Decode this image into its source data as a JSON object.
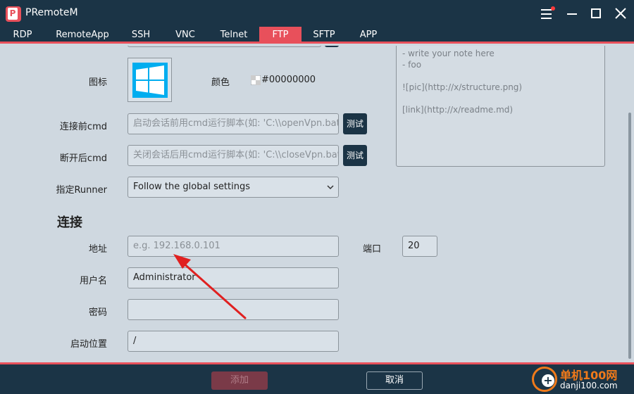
{
  "window": {
    "title": "PRemoteM",
    "logo_letter": "P"
  },
  "tabs": [
    {
      "label": "RDP",
      "active": false
    },
    {
      "label": "RemoteApp",
      "active": false
    },
    {
      "label": "SSH",
      "active": false
    },
    {
      "label": "VNC",
      "active": false
    },
    {
      "label": "Telnet",
      "active": false
    },
    {
      "label": "FTP",
      "active": true
    },
    {
      "label": "SFTP",
      "active": false
    },
    {
      "label": "APP",
      "active": false
    }
  ],
  "form": {
    "icon_label": "图标",
    "color_label": "颜色",
    "color_value": "#00000000",
    "pre_cmd_label": "连接前cmd",
    "pre_cmd_placeholder": "启动会话前用cmd运行脚本(如: 'C:\\\\openVpn.bat' #",
    "post_cmd_label": "断开后cmd",
    "post_cmd_placeholder": "关闭会话后用cmd运行脚本(如: 'C:\\\\closeVpn.bat' #",
    "test_label": "测试",
    "runner_label": "指定Runner",
    "runner_value": "Follow the global settings"
  },
  "note": {
    "lines": [
      "- write your note here",
      "- foo",
      "",
      "![pic](http://x/structure.png)",
      "",
      "[link](http://x/readme.md)"
    ]
  },
  "connection": {
    "section_title": "连接",
    "address_label": "地址",
    "address_placeholder": "e.g. 192.168.0.101",
    "port_label": "端口",
    "port_value": "20",
    "username_label": "用户名",
    "username_value": "Administrator",
    "password_label": "密码",
    "password_value": "",
    "startpath_label": "启动位置",
    "startpath_value": "/"
  },
  "footer": {
    "add_label": "添加",
    "cancel_label": "取消"
  },
  "watermark": {
    "line1": "单机100网",
    "line2": "danji100.com"
  },
  "colors": {
    "accent": "#e8505b",
    "dark": "#1b3446",
    "background": "#cfd8e0",
    "arrow": "#e02020",
    "windows_blue": "#00adef"
  },
  "icons": {
    "app_logo": "premotem-logo-icon",
    "menu": "hamburger-icon",
    "minimize": "minimize-icon",
    "maximize": "maximize-icon",
    "close": "close-icon",
    "server_icon": "windows-logo-icon",
    "color_swatch": "transparent-swatch-icon",
    "dropdown": "chevron-down-icon",
    "annotation": "red-arrow-icon"
  }
}
